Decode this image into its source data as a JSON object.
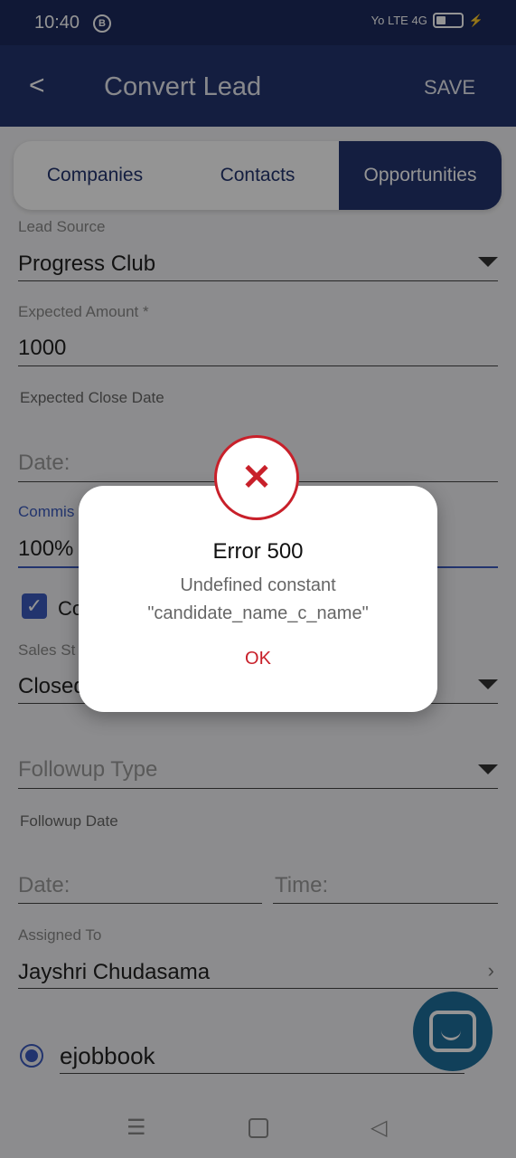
{
  "status": {
    "time": "10:40",
    "badge": "B",
    "network": "Yo LTE 4G"
  },
  "header": {
    "back": "<",
    "title": "Convert Lead",
    "save": "SAVE"
  },
  "tabs": [
    {
      "label": "Companies"
    },
    {
      "label": "Contacts"
    },
    {
      "label": "Opportunities"
    }
  ],
  "form": {
    "lead_source": {
      "label": "Lead Source",
      "value": "Progress Club"
    },
    "expected_amount": {
      "label": "Expected Amount *",
      "value": "1000"
    },
    "expected_close": {
      "label": "Expected Close Date",
      "placeholder": "Date:"
    },
    "commission": {
      "label": "Commis",
      "value": "100%"
    },
    "checkbox_label": "Co",
    "sales_stage": {
      "label": "Sales St",
      "value": "Closed"
    },
    "followup_type": {
      "placeholder": "Followup Type"
    },
    "followup_date": {
      "label": "Followup Date",
      "date_placeholder": "Date:",
      "time_placeholder": "Time:"
    },
    "assigned_to": {
      "label": "Assigned To",
      "value": "Jayshri Chudasama"
    },
    "radio_option": "ejobbook"
  },
  "dialog": {
    "title": "Error 500",
    "message": "Undefined constant \"candidate_name_c_name\"",
    "ok": "OK"
  },
  "icons": {
    "back": "chevron-left-icon",
    "dropdown": "caret-down-icon",
    "chat": "chat-icon",
    "error": "close-icon"
  },
  "colors": {
    "primary": "#24356f",
    "error": "#c8202a",
    "fab": "#1e6e9c"
  }
}
